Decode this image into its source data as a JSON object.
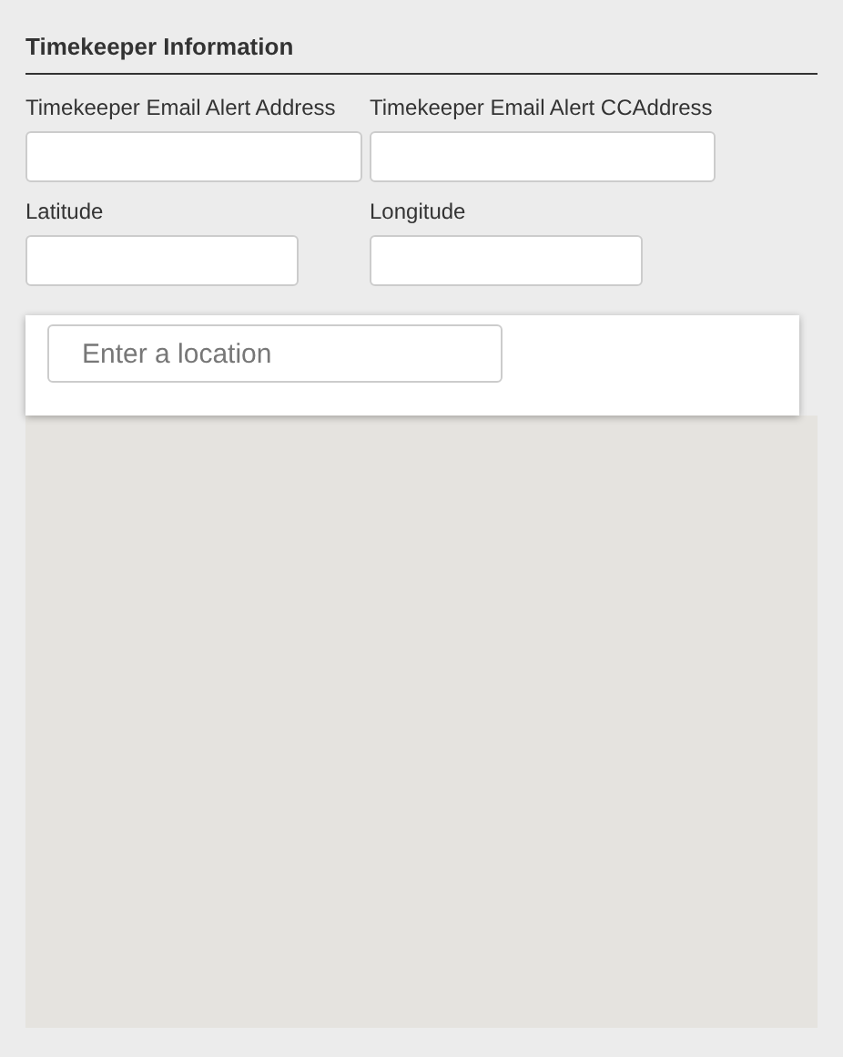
{
  "section": {
    "title": "Timekeeper Information"
  },
  "fields": [
    {
      "label": "Timekeeper Email Alert Address"
    },
    {
      "label": "Timekeeper Email Alert CCAddress"
    },
    {
      "label": "Latitude"
    },
    {
      "label": "Longitude"
    }
  ],
  "map": {
    "search": {
      "placeholder": "Enter a location"
    }
  }
}
